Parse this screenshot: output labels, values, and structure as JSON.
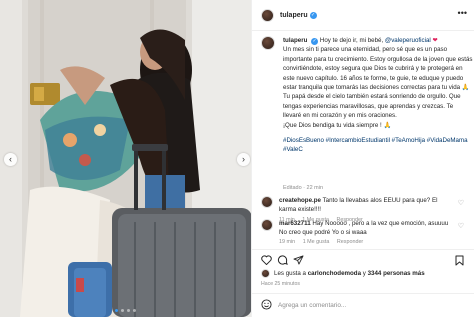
{
  "post": {
    "username": "tulaperu",
    "caption_lines": [
      "Hoy te dejo ir, mi bebé",
      "@valeperuoficial",
      "Un mes sin ti parece una eternidad, pero sé que es un paso importante para tu crecimiento. Estoy orgullosa de la joven que estás convirtiéndote, estoy segura que Dios te cubrirá y te protegerá en este nuevo capítulo. 16 años te forme, te guie, te eduque y puedo estar tranquila que tomarás las decisiones correctas para tu vida",
      "Tu papá desde el cielo también estará sonriendo de orgullo. Que tengas experiencias maravillosas, que aprendas y crezcas. Te llevaré en mi corazón y en mis oraciones.",
      "¡Que Dios bendiga tu vida siempre !"
    ],
    "hashtags": "#DiosEsBueno #IntercambioEstudiantil #TeAmoHija #VidaDeMama #ValeC",
    "edited": "Editado · 22 min"
  },
  "comments": [
    {
      "user": "createhope.pe",
      "text": "Tanto la llevabas alos EEUU para que? El karma existe!!!!",
      "time": "11 min",
      "likes": "1 Me gusta",
      "reply": "Responder"
    },
    {
      "user": "mar632711",
      "text": "Hay Nooooo , pero a la vez que emoción, asuuuu No creo que podré Yo o si waaa",
      "time": "19 min",
      "likes": "1 Me gusta",
      "reply": "Responder"
    }
  ],
  "likes": {
    "prefix": "Les gusta a",
    "user": "carlonchodemoda",
    "middle": "y",
    "count": "3344 personas más"
  },
  "time_ago": "Hace 25 minutos",
  "comment_box": {
    "placeholder": "Agrega un comentario..."
  },
  "icons": [
    "more-icon",
    "like-icon",
    "comment-icon",
    "share-icon",
    "save-icon",
    "emoji-icon",
    "prev-arrow-icon",
    "next-arrow-icon"
  ],
  "colors": {
    "link": "#00376b",
    "verified": "#3897f0",
    "meta": "#8e8e8e"
  }
}
